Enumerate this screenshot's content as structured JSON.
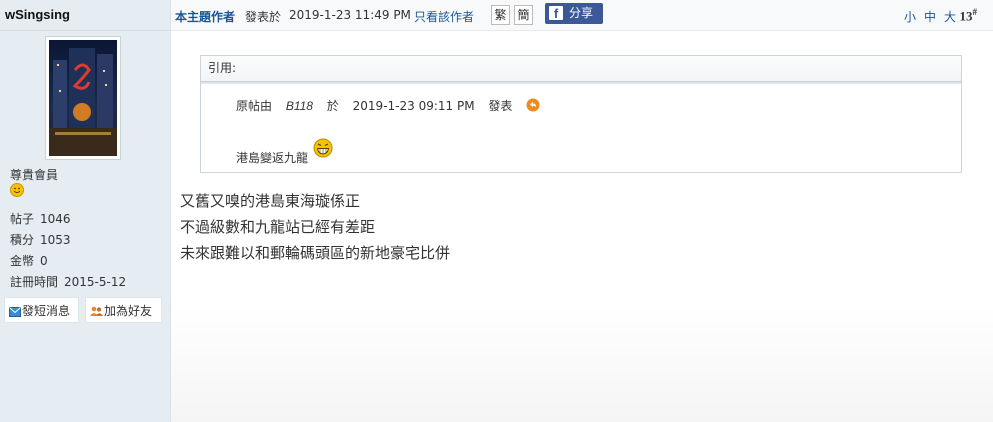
{
  "sidebar": {
    "username": "wSingsing",
    "rank": "尊貴會員",
    "stats": [
      {
        "label": "帖子",
        "value": "1046"
      },
      {
        "label": "積分",
        "value": "1053"
      },
      {
        "label": "金幣",
        "value": "0"
      },
      {
        "label": "註冊時間",
        "value": "2015-5-12"
      }
    ],
    "buttons": {
      "message": "發短消息",
      "add_friend": "加為好友"
    }
  },
  "topbar": {
    "thread_author": "本主題作者",
    "posted_label": "發表於",
    "post_datetime": "2019-1-23 11:49 PM",
    "only_author": "只看該作者",
    "traditional": "繁",
    "simplified": "簡",
    "share": "分享",
    "font_small": "小",
    "font_medium": "中",
    "font_large": "大",
    "post_number": "13",
    "post_symbol": "#"
  },
  "quote": {
    "header": "引用:",
    "prefix": "原帖由",
    "author": "B118",
    "at": "於",
    "datetime": "2019-1-23  09:11  PM",
    "posted": "發表",
    "text": "港島變返九龍"
  },
  "post": {
    "lines": [
      "又舊又嗅的港島東海璇係正",
      "不過級數和九龍站已經有差距",
      "未來跟難以和郵輪碼頭區的新地豪宅比併"
    ]
  },
  "colors": {
    "link": "#1a5694",
    "sidebar_bg": "#e5edf2",
    "facebook": "#3b5998"
  }
}
